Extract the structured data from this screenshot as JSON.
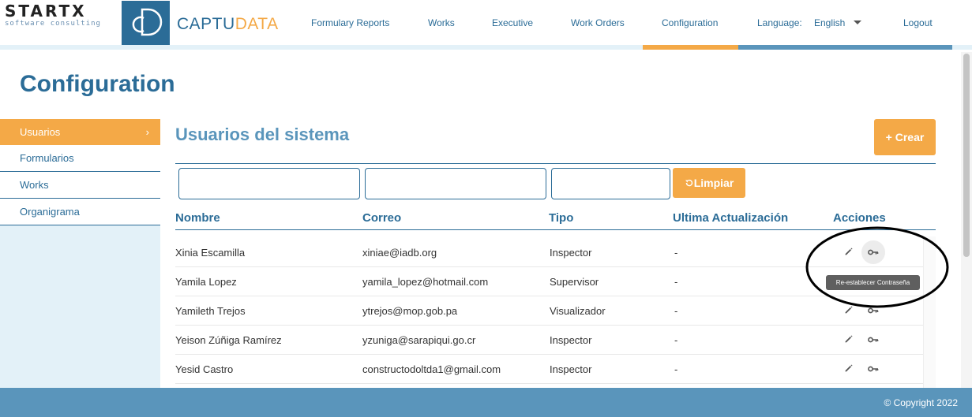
{
  "header": {
    "startx": {
      "main": "STARTX",
      "sub": "software consulting"
    },
    "brand": {
      "part1": "CAPTU",
      "part2": "DATA"
    },
    "nav": {
      "formulary_reports": "Formulary Reports",
      "works": "Works",
      "executive": "Executive",
      "work_orders": "Work Orders",
      "configuration": "Configuration",
      "language_label": "Language:",
      "language_value": "English",
      "logout": "Logout"
    }
  },
  "page": {
    "title": "Configuration"
  },
  "sidebar": {
    "items": [
      {
        "label": "Usuarios",
        "active": true,
        "chevron": "›"
      },
      {
        "label": "Formularios"
      },
      {
        "label": "Works"
      },
      {
        "label": "Organigrama"
      }
    ]
  },
  "content": {
    "title": "Usuarios del sistema",
    "create_button": "+ Crear",
    "filters": [
      {
        "value": ""
      },
      {
        "value": ""
      },
      {
        "value": ""
      }
    ],
    "clear_button": "Limpiar",
    "table": {
      "headers": [
        "Nombre",
        "Correo",
        "Tipo",
        "Ultima Actualización",
        "Acciones"
      ],
      "rows": [
        {
          "name": "Xinia Escamilla",
          "email": "xiniae@iadb.org",
          "type": "Inspector",
          "updated": "-"
        },
        {
          "name": "Yamila Lopez",
          "email": "yamila_lopez@hotmail.com",
          "type": "Supervisor",
          "updated": "-"
        },
        {
          "name": "Yamileth Trejos",
          "email": "ytrejos@mop.gob.pa",
          "type": "Visualizador",
          "updated": "-"
        },
        {
          "name": "Yeison Zúñiga Ramírez",
          "email": "yzuniga@sarapiqui.go.cr",
          "type": "Inspector",
          "updated": "-"
        },
        {
          "name": "Yesid Castro",
          "email": "constructodoltda1@gmail.com",
          "type": "Inspector",
          "updated": "-"
        }
      ]
    },
    "tooltip": "Re-establecer Contraseña"
  },
  "footer": {
    "copyright": "© Copyright 2022"
  },
  "colors": {
    "primary": "#2b6c97",
    "accent": "#f4a947",
    "light": "#e3f1f8",
    "footer": "#5a95bb"
  },
  "icons": {
    "edit": "pencil-icon",
    "reset": "key-icon",
    "clear": "restore-icon"
  }
}
